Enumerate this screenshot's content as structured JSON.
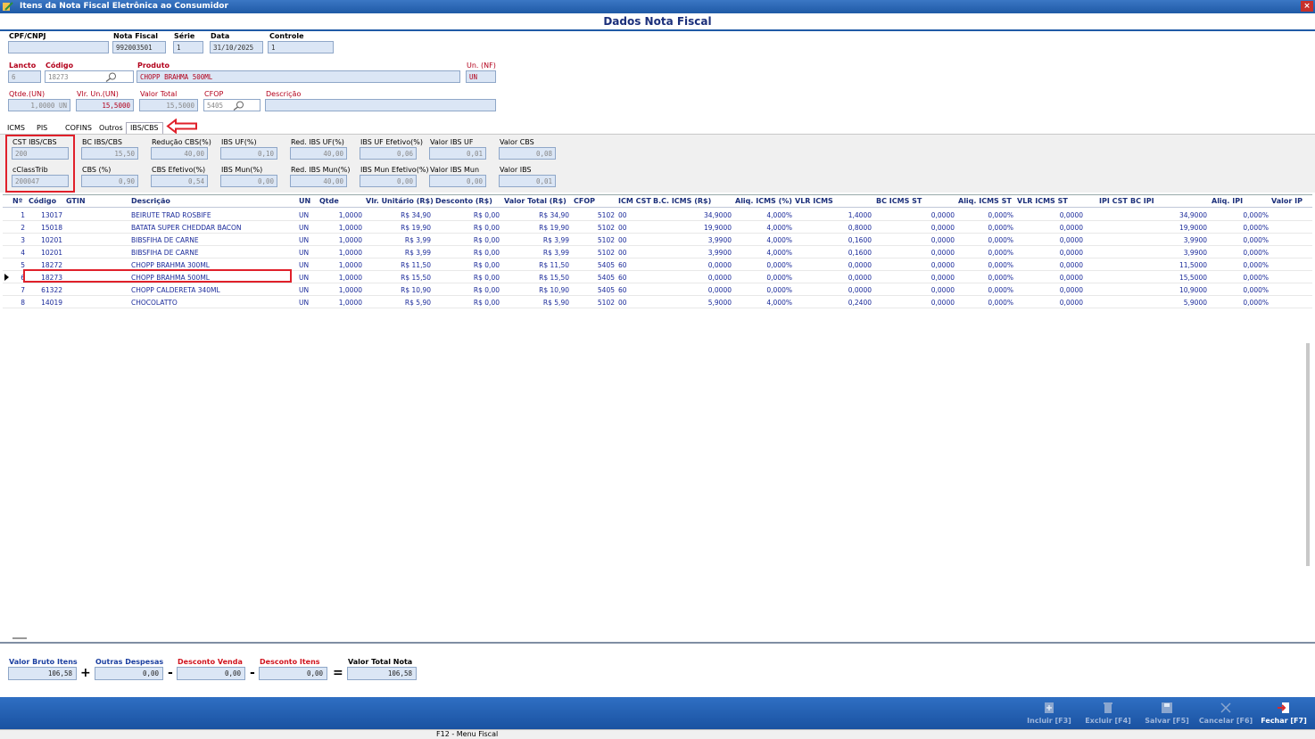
{
  "window": {
    "title": "Itens da Nota Fiscal Eletrônica ao Consumidor",
    "close": "×"
  },
  "heading": "Dados Nota Fiscal",
  "header": {
    "cpf_label": "CPF/CNPJ",
    "cpf_value": "",
    "nota_label": "Nota Fiscal",
    "nota_value": "992003501",
    "serie_label": "Série",
    "serie_value": "1",
    "data_label": "Data",
    "data_value": "31/10/2025",
    "controle_label": "Controle",
    "controle_value": "1"
  },
  "item": {
    "lancto_label": "Lancto",
    "lancto_value": "6",
    "codigo_label": "Código",
    "codigo_value": "18273",
    "produto_label": "Produto",
    "produto_value": "CHOPP BRAHMA 500ML",
    "un_label": "Un. (NF)",
    "un_value": "UN",
    "qtde_label": "Qtde.(UN)",
    "qtde_value": "1,0000 UN",
    "vlrun_label": "Vlr. Un.(UN)",
    "vlrun_value": "15,5000",
    "valortotal_label": "Valor Total",
    "valortotal_value": "15,5000",
    "cfop_label": "CFOP",
    "cfop_value": "5405",
    "descricao_label": "Descrição",
    "descricao_value": ""
  },
  "tabs": [
    "ICMS",
    "PIS",
    "COFINS",
    "Outros",
    "IBS/CBS"
  ],
  "ibs": {
    "cst_label": "CST IBS/CBS",
    "cst_value": "200",
    "bc_label": "BC IBS/CBS",
    "bc_value": "15,50",
    "reducao_label": "Redução CBS(%)",
    "reducao_value": "40,00",
    "ibsuf_label": "IBS UF(%)",
    "ibsuf_value": "0,10",
    "redibsuf_label": "Red. IBS UF(%)",
    "redibsuf_value": "40,00",
    "ibsufef_label": "IBS UF Efetivo(%)",
    "ibsufef_value": "0,06",
    "valoribsuf_label": "Valor IBS UF",
    "valoribsuf_value": "0,01",
    "valorcbs_label": "Valor CBS",
    "valorcbs_value": "0,08",
    "cclass_label": "cClassTrib",
    "cclass_value": "200047",
    "cbs_label": "CBS (%)",
    "cbs_value": "0,90",
    "cbsef_label": "CBS Efetivo(%)",
    "cbsef_value": "0,54",
    "ibsmun_label": "IBS Mun(%)",
    "ibsmun_value": "0,00",
    "redibsmun_label": "Red. IBS Mun(%)",
    "redibsmun_value": "40,00",
    "ibsmunef_label": "IBS Mun Efetivo(%)",
    "ibsmunef_value": "0,00",
    "valoribsmun_label": "Valor IBS Mun",
    "valoribsmun_value": "0,00",
    "valoribs_label": "Valor IBS",
    "valoribs_value": "0,01"
  },
  "grid": {
    "columns": [
      "Nº",
      "Código",
      "GTIN",
      "Descrição",
      "UN",
      "Qtde",
      "Vlr. Unitário (R$)",
      "Desconto (R$)",
      "Valor Total (R$)",
      "CFOP",
      "ICM CST",
      "B.C. ICMS (R$)",
      "Aliq. ICMS (%)",
      "VLR ICMS",
      "BC ICMS ST",
      "Aliq. ICMS ST",
      "VLR ICMS ST",
      "IPI CST",
      "BC IPI",
      "Aliq. IPI",
      "Valor IP"
    ],
    "rows": [
      [
        "1",
        "13017",
        "",
        "BEIRUTE TRAD ROSBIFE",
        "UN",
        "1,0000",
        "R$ 34,90",
        "R$ 0,00",
        "R$ 34,90",
        "5102",
        "00",
        "34,9000",
        "4,000%",
        "1,4000",
        "0,0000",
        "0,000%",
        "0,0000",
        "",
        "34,9000",
        "0,000%",
        ""
      ],
      [
        "2",
        "15018",
        "",
        "BATATA SUPER CHEDDAR BACON",
        "UN",
        "1,0000",
        "R$ 19,90",
        "R$ 0,00",
        "R$ 19,90",
        "5102",
        "00",
        "19,9000",
        "4,000%",
        "0,8000",
        "0,0000",
        "0,000%",
        "0,0000",
        "",
        "19,9000",
        "0,000%",
        ""
      ],
      [
        "3",
        "10201",
        "",
        "BIBSFIHA DE CARNE",
        "UN",
        "1,0000",
        "R$ 3,99",
        "R$ 0,00",
        "R$ 3,99",
        "5102",
        "00",
        "3,9900",
        "4,000%",
        "0,1600",
        "0,0000",
        "0,000%",
        "0,0000",
        "",
        "3,9900",
        "0,000%",
        ""
      ],
      [
        "4",
        "10201",
        "",
        "BIBSFIHA DE CARNE",
        "UN",
        "1,0000",
        "R$ 3,99",
        "R$ 0,00",
        "R$ 3,99",
        "5102",
        "00",
        "3,9900",
        "4,000%",
        "0,1600",
        "0,0000",
        "0,000%",
        "0,0000",
        "",
        "3,9900",
        "0,000%",
        ""
      ],
      [
        "5",
        "18272",
        "",
        "CHOPP BRAHMA 300ML",
        "UN",
        "1,0000",
        "R$ 11,50",
        "R$ 0,00",
        "R$ 11,50",
        "5405",
        "60",
        "0,0000",
        "0,000%",
        "0,0000",
        "0,0000",
        "0,000%",
        "0,0000",
        "",
        "11,5000",
        "0,000%",
        ""
      ],
      [
        "6",
        "18273",
        "",
        "CHOPP BRAHMA 500ML",
        "UN",
        "1,0000",
        "R$ 15,50",
        "R$ 0,00",
        "R$ 15,50",
        "5405",
        "60",
        "0,0000",
        "0,000%",
        "0,0000",
        "0,0000",
        "0,000%",
        "0,0000",
        "",
        "15,5000",
        "0,000%",
        ""
      ],
      [
        "7",
        "61322",
        "",
        "CHOPP CALDERETA 340ML",
        "UN",
        "1,0000",
        "R$ 10,90",
        "R$ 0,00",
        "R$ 10,90",
        "5405",
        "60",
        "0,0000",
        "0,000%",
        "0,0000",
        "0,0000",
        "0,000%",
        "0,0000",
        "",
        "10,9000",
        "0,000%",
        ""
      ],
      [
        "8",
        "14019",
        "",
        "CHOCOLATTO",
        "UN",
        "1,0000",
        "R$ 5,90",
        "R$ 0,00",
        "R$ 5,90",
        "5102",
        "00",
        "5,9000",
        "4,000%",
        "0,2400",
        "0,0000",
        "0,000%",
        "0,0000",
        "",
        "5,9000",
        "0,000%",
        ""
      ]
    ]
  },
  "totals": {
    "bruto_label": "Valor Bruto Itens",
    "bruto_value": "106,58",
    "outras_label": "Outras Despesas",
    "outras_value": "0,00",
    "descvenda_label": "Desconto Venda",
    "descvenda_value": "0,00",
    "descitens_label": "Desconto Itens",
    "descitens_value": "0,00",
    "total_label": "Valor Total Nota",
    "total_value": "106,58",
    "op_plus": "+",
    "op_minus": "-",
    "op_equals": "="
  },
  "toolbar": {
    "incluir": "Incluir [F3]",
    "excluir": "Excluir [F4]",
    "salvar": "Salvar [F5]",
    "cancelar": "Cancelar [F6]",
    "fechar": "Fechar [F7]"
  },
  "status": "F12 - Menu Fiscal",
  "colors": {
    "accent": "#1f5aa6",
    "highlight_box": "#e0202a",
    "grid_text": "#1a2a9a"
  }
}
